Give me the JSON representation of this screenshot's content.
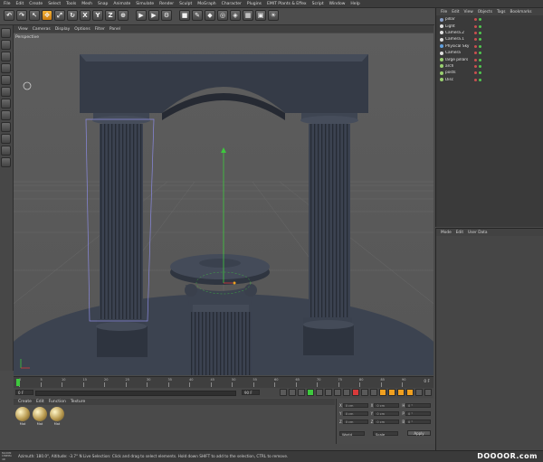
{
  "menubar": {
    "items": [
      "File",
      "Edit",
      "Create",
      "Select",
      "Tools",
      "Mesh",
      "Snap",
      "Animate",
      "Simulate",
      "Render",
      "Sculpt",
      "MoGraph",
      "Character",
      "Plugins",
      "EMIT Plants & Effex",
      "Script",
      "Window",
      "Help"
    ]
  },
  "viewport": {
    "menu": [
      "View",
      "Cameras",
      "Display",
      "Options",
      "Filter",
      "Panel"
    ],
    "label": "Perspective"
  },
  "objects": {
    "menu": [
      "File",
      "Edit",
      "View",
      "Objects",
      "Tags",
      "Bookmarks"
    ],
    "items": [
      {
        "name": "pillar",
        "color": "#8aa0c8"
      },
      {
        "name": "Light",
        "color": "#e0e0e0"
      },
      {
        "name": "Camera.2",
        "color": "#e0e0e0"
      },
      {
        "name": "Camera.1",
        "color": "#e0e0e0"
      },
      {
        "name": "Physical Sky",
        "color": "#60a0e0"
      },
      {
        "name": "Camera",
        "color": "#e0e0e0"
      },
      {
        "name": "large pillars",
        "color": "#9ad070"
      },
      {
        "name": "arch",
        "color": "#9ad070"
      },
      {
        "name": "posts",
        "color": "#9ad070"
      },
      {
        "name": "Disc",
        "color": "#9ad070"
      }
    ]
  },
  "attributes": {
    "menu": [
      "Mode",
      "Edit",
      "User Data"
    ]
  },
  "materials": {
    "menu": [
      "Create",
      "Edit",
      "Function",
      "Texture"
    ],
    "swatches": [
      "Mat",
      "Mat",
      "Mat"
    ]
  },
  "timeline": {
    "ticks": [
      "0",
      "5",
      "10",
      "15",
      "20",
      "25",
      "30",
      "35",
      "40",
      "45",
      "50",
      "55",
      "60",
      "65",
      "70",
      "75",
      "80",
      "85",
      "90"
    ],
    "end_label": "0 F",
    "frame_start": "0 F",
    "frame_end": "90 F"
  },
  "coords": {
    "rows": [
      {
        "a": "X",
        "av": "0 cm",
        "b": "X",
        "bv": "0 cm",
        "c": "H",
        "cv": "0 °"
      },
      {
        "a": "Y",
        "av": "0 cm",
        "b": "Y",
        "bv": "0 cm",
        "c": "P",
        "cv": "0 °"
      },
      {
        "a": "Z",
        "av": "0 cm",
        "b": "Z",
        "bv": "0 cm",
        "c": "B",
        "cv": "0 °"
      }
    ],
    "mode1": "World",
    "mode2": "Scale",
    "apply_label": "Apply"
  },
  "status": {
    "text": "Azimuth: 180.0°, Altitude: -3.7°  N    Live Selection: Click and drag to select elements. Hold down SHIFT to add to the selection, CTRL to remove.",
    "watermark": "DOOOOR.com",
    "brand": "MAXON CINEMA 4D"
  },
  "colors": {
    "accent": "#f0a020",
    "viewport_bg": "#5a5a5a",
    "floor": "#3c4350",
    "axis_green": "#3ec83e",
    "axis_red": "#d83a3a",
    "axis_blue": "#3a6ad8"
  },
  "toolbar": {
    "icons": [
      "undo-icon",
      "redo-icon",
      "select-icon",
      "move-icon",
      "scale-icon",
      "rotate-icon",
      "x-axis-icon",
      "y-axis-icon",
      "z-axis-icon",
      "world-coord-icon",
      "render-view-icon",
      "render-pic-icon",
      "render-settings-icon",
      "cube-icon",
      "pen-icon",
      "subdivision-icon",
      "array-icon",
      "deformer-icon",
      "floor-icon",
      "camera-icon",
      "light-icon"
    ],
    "labels": [
      "↶",
      "↷",
      "↖",
      "✥",
      "⤢",
      "↻",
      "X",
      "Y",
      "Z",
      "⊕",
      "▶",
      "▶",
      "⚙",
      "■",
      "✎",
      "◆",
      "◎",
      "◈",
      "▦",
      "▣",
      "☀"
    ]
  }
}
